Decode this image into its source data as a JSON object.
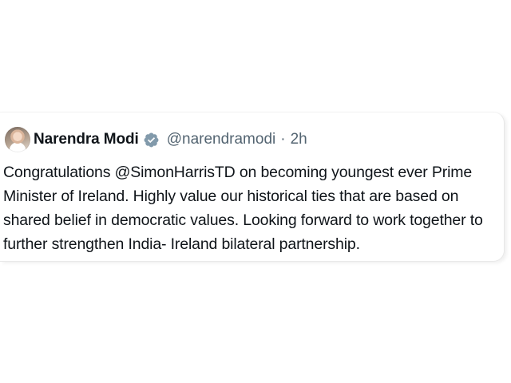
{
  "tweet": {
    "author_name": "Narendra Modi",
    "handle": "@narendramodi",
    "separator": "·",
    "time": "2h",
    "verified": true,
    "verified_color": "#829aab",
    "text_lines": [
      "Congratulations @SimonHarrisTD on becoming youngest ever Prime",
      "Minister of Ireland. Highly value our historical ties that are based on",
      "shared belief in democratic values. Looking forward to work together to",
      "further strengthen India- Ireland bilateral partnership."
    ]
  },
  "icons": {
    "avatar": "profile-photo",
    "badge": "verified-badge-icon"
  }
}
